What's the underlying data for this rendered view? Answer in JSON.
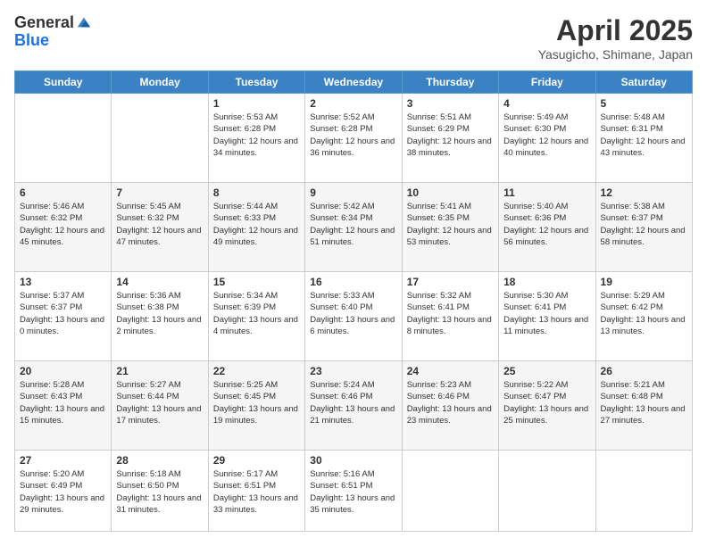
{
  "logo": {
    "general": "General",
    "blue": "Blue"
  },
  "title": "April 2025",
  "subtitle": "Yasugicho, Shimane, Japan",
  "days_of_week": [
    "Sunday",
    "Monday",
    "Tuesday",
    "Wednesday",
    "Thursday",
    "Friday",
    "Saturday"
  ],
  "weeks": [
    [
      null,
      null,
      {
        "day": 1,
        "sunrise": "5:53 AM",
        "sunset": "6:28 PM",
        "daylight": "12 hours and 34 minutes."
      },
      {
        "day": 2,
        "sunrise": "5:52 AM",
        "sunset": "6:28 PM",
        "daylight": "12 hours and 36 minutes."
      },
      {
        "day": 3,
        "sunrise": "5:51 AM",
        "sunset": "6:29 PM",
        "daylight": "12 hours and 38 minutes."
      },
      {
        "day": 4,
        "sunrise": "5:49 AM",
        "sunset": "6:30 PM",
        "daylight": "12 hours and 40 minutes."
      },
      {
        "day": 5,
        "sunrise": "5:48 AM",
        "sunset": "6:31 PM",
        "daylight": "12 hours and 43 minutes."
      }
    ],
    [
      {
        "day": 6,
        "sunrise": "5:46 AM",
        "sunset": "6:32 PM",
        "daylight": "12 hours and 45 minutes."
      },
      {
        "day": 7,
        "sunrise": "5:45 AM",
        "sunset": "6:32 PM",
        "daylight": "12 hours and 47 minutes."
      },
      {
        "day": 8,
        "sunrise": "5:44 AM",
        "sunset": "6:33 PM",
        "daylight": "12 hours and 49 minutes."
      },
      {
        "day": 9,
        "sunrise": "5:42 AM",
        "sunset": "6:34 PM",
        "daylight": "12 hours and 51 minutes."
      },
      {
        "day": 10,
        "sunrise": "5:41 AM",
        "sunset": "6:35 PM",
        "daylight": "12 hours and 53 minutes."
      },
      {
        "day": 11,
        "sunrise": "5:40 AM",
        "sunset": "6:36 PM",
        "daylight": "12 hours and 56 minutes."
      },
      {
        "day": 12,
        "sunrise": "5:38 AM",
        "sunset": "6:37 PM",
        "daylight": "12 hours and 58 minutes."
      }
    ],
    [
      {
        "day": 13,
        "sunrise": "5:37 AM",
        "sunset": "6:37 PM",
        "daylight": "13 hours and 0 minutes."
      },
      {
        "day": 14,
        "sunrise": "5:36 AM",
        "sunset": "6:38 PM",
        "daylight": "13 hours and 2 minutes."
      },
      {
        "day": 15,
        "sunrise": "5:34 AM",
        "sunset": "6:39 PM",
        "daylight": "13 hours and 4 minutes."
      },
      {
        "day": 16,
        "sunrise": "5:33 AM",
        "sunset": "6:40 PM",
        "daylight": "13 hours and 6 minutes."
      },
      {
        "day": 17,
        "sunrise": "5:32 AM",
        "sunset": "6:41 PM",
        "daylight": "13 hours and 8 minutes."
      },
      {
        "day": 18,
        "sunrise": "5:30 AM",
        "sunset": "6:41 PM",
        "daylight": "13 hours and 11 minutes."
      },
      {
        "day": 19,
        "sunrise": "5:29 AM",
        "sunset": "6:42 PM",
        "daylight": "13 hours and 13 minutes."
      }
    ],
    [
      {
        "day": 20,
        "sunrise": "5:28 AM",
        "sunset": "6:43 PM",
        "daylight": "13 hours and 15 minutes."
      },
      {
        "day": 21,
        "sunrise": "5:27 AM",
        "sunset": "6:44 PM",
        "daylight": "13 hours and 17 minutes."
      },
      {
        "day": 22,
        "sunrise": "5:25 AM",
        "sunset": "6:45 PM",
        "daylight": "13 hours and 19 minutes."
      },
      {
        "day": 23,
        "sunrise": "5:24 AM",
        "sunset": "6:46 PM",
        "daylight": "13 hours and 21 minutes."
      },
      {
        "day": 24,
        "sunrise": "5:23 AM",
        "sunset": "6:46 PM",
        "daylight": "13 hours and 23 minutes."
      },
      {
        "day": 25,
        "sunrise": "5:22 AM",
        "sunset": "6:47 PM",
        "daylight": "13 hours and 25 minutes."
      },
      {
        "day": 26,
        "sunrise": "5:21 AM",
        "sunset": "6:48 PM",
        "daylight": "13 hours and 27 minutes."
      }
    ],
    [
      {
        "day": 27,
        "sunrise": "5:20 AM",
        "sunset": "6:49 PM",
        "daylight": "13 hours and 29 minutes."
      },
      {
        "day": 28,
        "sunrise": "5:18 AM",
        "sunset": "6:50 PM",
        "daylight": "13 hours and 31 minutes."
      },
      {
        "day": 29,
        "sunrise": "5:17 AM",
        "sunset": "6:51 PM",
        "daylight": "13 hours and 33 minutes."
      },
      {
        "day": 30,
        "sunrise": "5:16 AM",
        "sunset": "6:51 PM",
        "daylight": "13 hours and 35 minutes."
      },
      null,
      null,
      null
    ]
  ],
  "labels": {
    "sunrise": "Sunrise:",
    "sunset": "Sunset:",
    "daylight": "Daylight:"
  }
}
